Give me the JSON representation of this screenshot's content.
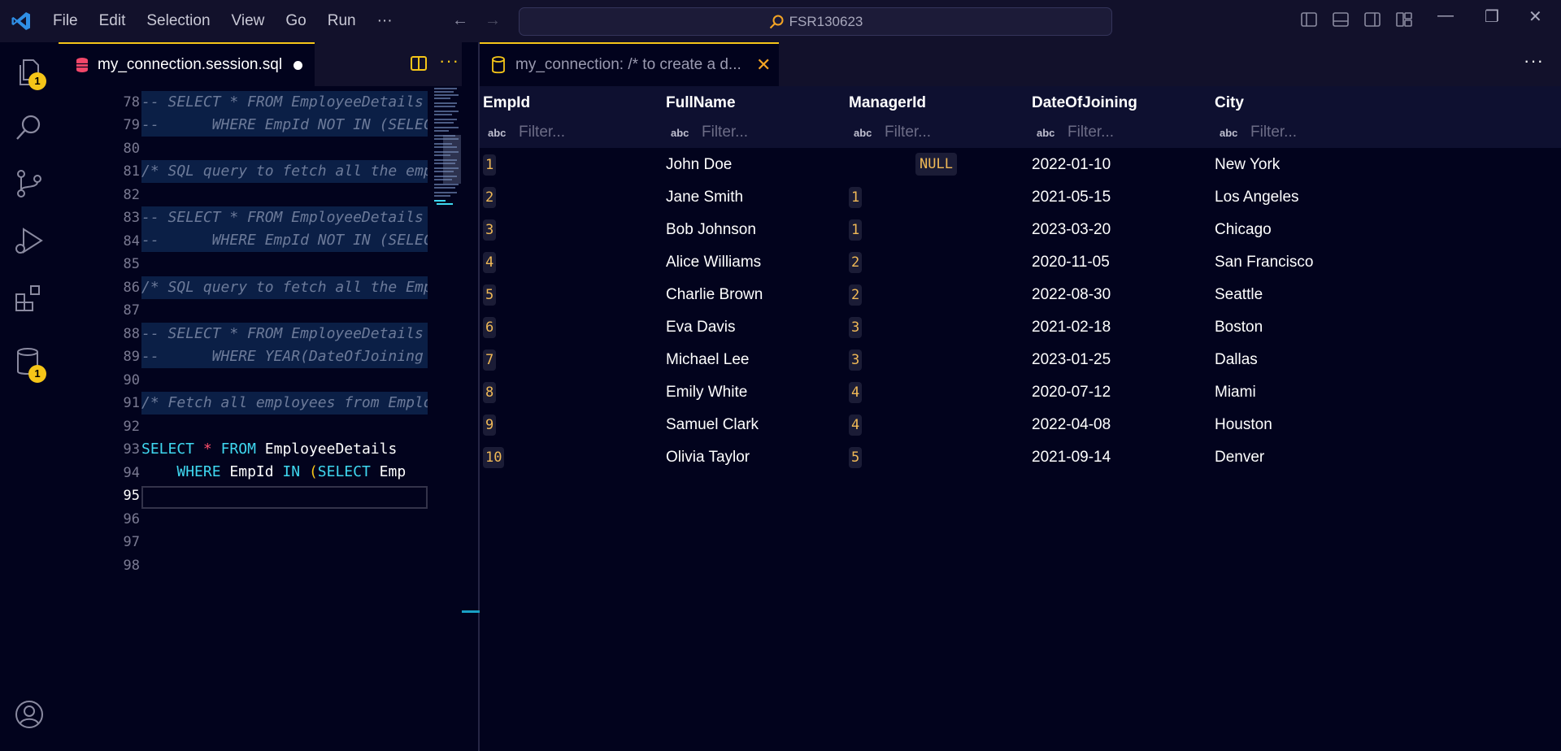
{
  "menu": [
    "File",
    "Edit",
    "Selection",
    "View",
    "Go",
    "Run",
    "···"
  ],
  "search": {
    "text": "FSR130623"
  },
  "activity_badges": {
    "explorer": "1",
    "database": "1"
  },
  "editor_tab": {
    "label": "my_connection.session.sql"
  },
  "results_tab": {
    "label": "my_connection: /* to create a d...",
    "close": "✕"
  },
  "editor": {
    "line_numbers": [
      "78",
      "79",
      "80",
      "81",
      "82",
      "83",
      "84",
      "85",
      "86",
      "87",
      "88",
      "89",
      "90",
      "91",
      "92",
      "93",
      "94",
      "95",
      "96",
      "97",
      "98"
    ],
    "comment_lines": {
      "l78": "-- SELECT * FROM EmployeeDetails",
      "l79": "--      WHERE EmpId NOT IN (SELECT",
      "l81": "/* SQL query to fetch all the emp",
      "l83": "-- SELECT * FROM EmployeeDetails",
      "l84": "--      WHERE EmpId NOT IN (SELECT",
      "l86": "/* SQL query to fetch all the Emp",
      "l88": "-- SELECT * FROM EmployeeDetails",
      "l89": "--      WHERE YEAR(DateOfJoining",
      "l91": "/* Fetch all employees from Emplo"
    },
    "line93": {
      "kw1": "SELECT",
      "star": "*",
      "kw2": "FROM",
      "table": "EmployeeDetails"
    },
    "line94": {
      "kw1": "WHERE",
      "col": "EmpId",
      "kw2": "IN",
      "paren": "(",
      "kw3": "SELECT",
      "rest": "Emp"
    }
  },
  "results": {
    "columns": [
      "EmpId",
      "FullName",
      "ManagerId",
      "DateOfJoining",
      "City"
    ],
    "filter_placeholder": "Filter...",
    "filter_icon": "abc",
    "rows": [
      {
        "id": "1",
        "name": "John Doe",
        "mgr": "NULL",
        "date": "2022-01-10",
        "city": "New York"
      },
      {
        "id": "2",
        "name": "Jane Smith",
        "mgr": "1",
        "date": "2021-05-15",
        "city": "Los Angeles"
      },
      {
        "id": "3",
        "name": "Bob Johnson",
        "mgr": "1",
        "date": "2023-03-20",
        "city": "Chicago"
      },
      {
        "id": "4",
        "name": "Alice Williams",
        "mgr": "2",
        "date": "2020-11-05",
        "city": "San Francisco"
      },
      {
        "id": "5",
        "name": "Charlie Brown",
        "mgr": "2",
        "date": "2022-08-30",
        "city": "Seattle"
      },
      {
        "id": "6",
        "name": "Eva Davis",
        "mgr": "3",
        "date": "2021-02-18",
        "city": "Boston"
      },
      {
        "id": "7",
        "name": "Michael Lee",
        "mgr": "3",
        "date": "2023-01-25",
        "city": "Dallas"
      },
      {
        "id": "8",
        "name": "Emily White",
        "mgr": "4",
        "date": "2020-07-12",
        "city": "Miami"
      },
      {
        "id": "9",
        "name": "Samuel Clark",
        "mgr": "4",
        "date": "2022-04-08",
        "city": "Houston"
      },
      {
        "id": "10",
        "name": "Olivia Taylor",
        "mgr": "5",
        "date": "2021-09-14",
        "city": "Denver"
      }
    ]
  },
  "colors": {
    "accent": "#f5c518",
    "keyword": "#3fd8f0",
    "number": "#f0b957",
    "background": "#02031d"
  }
}
